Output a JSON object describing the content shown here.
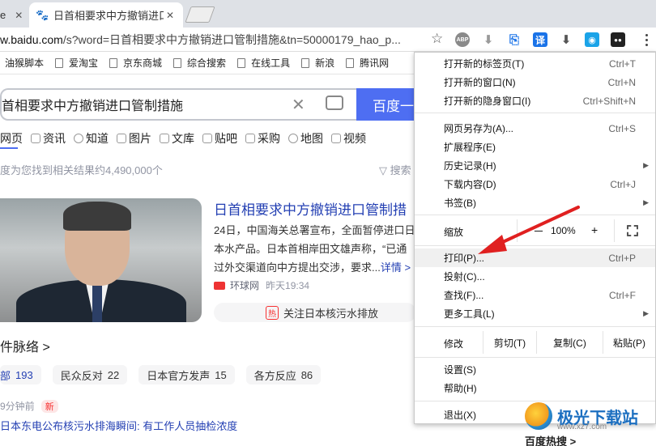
{
  "browser": {
    "tabs": [
      {
        "title": "e",
        "close": "✕"
      },
      {
        "title": "日首相要求中方撤销进口",
        "close": "✕"
      }
    ],
    "url": {
      "host": "w.baidu.com",
      "path": "/s?word=日首相要求中方撤销进口管制措施&tn=50000179_hao_p..."
    },
    "extensions": [
      {
        "name": "abp-icon",
        "label": "ABP",
        "color": "#888888"
      },
      {
        "name": "download-arrow-icon",
        "label": "⬇",
        "color": "#999999"
      },
      {
        "name": "translate-page-icon",
        "label": "⎘",
        "color": "#1a73e8"
      },
      {
        "name": "translate-icon",
        "label": "译",
        "color": "#1a73e8"
      },
      {
        "name": "download-icon",
        "label": "⬇",
        "color": "#555555"
      },
      {
        "name": "screenshot-icon",
        "label": "◉",
        "color": "#1aa3e8"
      },
      {
        "name": "tampermonkey-icon",
        "label": "●●",
        "color": "#222222"
      }
    ]
  },
  "bookmarks": [
    "油猴脚本",
    "爱淘宝",
    "京东商城",
    "综合搜索",
    "在线工具",
    "新浪",
    "腾讯网"
  ],
  "search": {
    "query": "首相要求中方撤销进口管制措施",
    "button": "百度一"
  },
  "nav_tabs": [
    "网页",
    "资讯",
    "知道",
    "图片",
    "文库",
    "贴吧",
    "采购",
    "地图",
    "视频"
  ],
  "result_count": "度为您找到相关结果约4,490,000个",
  "search_tools": "搜索",
  "news": {
    "title": "日首相要求中方撤销进口管制措",
    "body": "24日，中国海关总署宣布，全面暂停进口日本水产品。日本首相岸田文雄声称，“已通过外交渠道向中方提出交涉，要求...",
    "more": "详情 >",
    "source": "环球网",
    "time": "昨天19:34",
    "hot_tag": "热",
    "hot_text": "关注日本核污水排放"
  },
  "timeline": {
    "title": "件脉络 >",
    "chips": [
      {
        "label": "部",
        "count": "193"
      },
      {
        "label": "民众反对",
        "count": "22"
      },
      {
        "label": "日本官方发声",
        "count": "15"
      },
      {
        "label": "各方反应",
        "count": "86"
      }
    ]
  },
  "news_item": {
    "meta": "9分钟前",
    "new_tag": "新",
    "title": "日本东电公布核污水排海瞬间: 有工作人员抽检浓度"
  },
  "menu": {
    "group1": [
      {
        "label": "打开新的标签页(T)",
        "shortcut": "Ctrl+T"
      },
      {
        "label": "打开新的窗口(N)",
        "shortcut": "Ctrl+N"
      },
      {
        "label": "打开新的隐身窗口(I)",
        "shortcut": "Ctrl+Shift+N"
      }
    ],
    "group2": [
      {
        "label": "网页另存为(A)...",
        "shortcut": "Ctrl+S"
      },
      {
        "label": "扩展程序(E)",
        "shortcut": ""
      },
      {
        "label": "历史记录(H)",
        "shortcut": "",
        "submenu": true
      },
      {
        "label": "下载内容(D)",
        "shortcut": "Ctrl+J"
      },
      {
        "label": "书签(B)",
        "shortcut": "",
        "submenu": true
      }
    ],
    "zoom": {
      "label": "缩放",
      "minus": "－",
      "value": "100%",
      "plus": "+"
    },
    "group3": [
      {
        "label": "打印(P)...",
        "shortcut": "Ctrl+P"
      },
      {
        "label": "投射(C)...",
        "shortcut": ""
      },
      {
        "label": "查找(F)...",
        "shortcut": "Ctrl+F"
      },
      {
        "label": "更多工具(L)",
        "shortcut": "",
        "submenu": true
      }
    ],
    "edit": {
      "label": "修改",
      "cut": "剪切(T)",
      "copy": "复制(C)",
      "paste": "粘贴(P)"
    },
    "group4": [
      {
        "label": "设置(S)",
        "shortcut": ""
      },
      {
        "label": "帮助(H)",
        "shortcut": ""
      }
    ],
    "exit": {
      "label": "退出(X)"
    }
  },
  "watermark": {
    "text": "极光下载站",
    "url": "www.xz7.com"
  },
  "hot_bottom": "百度热搜 >",
  "colors": {
    "accent": "#4e6ef2",
    "link": "#2440b3",
    "annotation": "#e02020"
  }
}
